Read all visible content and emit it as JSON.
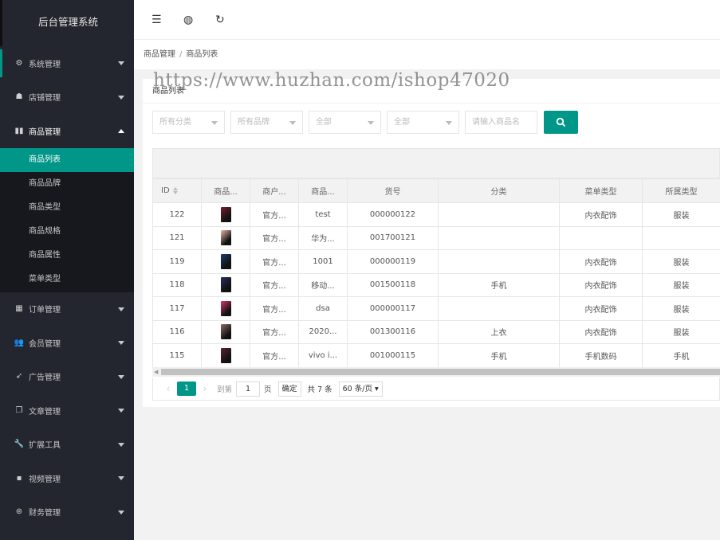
{
  "sidebar": {
    "brand": "后台管理系统",
    "items": [
      {
        "label": "系统管理",
        "icon": "gear-icon",
        "glyph": "⚙"
      },
      {
        "label": "店铺管理",
        "icon": "shop-icon",
        "glyph": "☗"
      },
      {
        "label": "商品管理",
        "icon": "chart-icon",
        "glyph": "▮▮"
      },
      {
        "label": "订单管理",
        "icon": "calendar-icon",
        "glyph": "▦"
      },
      {
        "label": "会员管理",
        "icon": "users-icon",
        "glyph": "👥"
      },
      {
        "label": "广告管理",
        "icon": "rocket-icon",
        "glyph": "➶"
      },
      {
        "label": "文章管理",
        "icon": "document-icon",
        "glyph": "❐"
      },
      {
        "label": "扩展工具",
        "icon": "wrench-icon",
        "glyph": "🔧"
      },
      {
        "label": "视频管理",
        "icon": "camera-icon",
        "glyph": "▪"
      },
      {
        "label": "财务管理",
        "icon": "finance-icon",
        "glyph": "⊛"
      }
    ],
    "submenu": [
      "商品列表",
      "商品品牌",
      "商品类型",
      "商品规格",
      "商品属性",
      "菜单类型"
    ]
  },
  "topbar": {
    "icons": [
      {
        "name": "menu-toggle-icon",
        "glyph": "☰"
      },
      {
        "name": "globe-icon",
        "glyph": "◍"
      },
      {
        "name": "refresh-icon",
        "glyph": "↻"
      }
    ]
  },
  "breadcrumb": {
    "parent": "商品管理",
    "separator": "/",
    "current": "商品列表"
  },
  "watermark": "https://www.huzhan.com/ishop47020",
  "card": {
    "title": "商品列表",
    "filters": {
      "category": "所有分类",
      "brand": "所有品牌",
      "all1": "全部",
      "all2": "全部",
      "search_placeholder": "请输入商品名"
    },
    "table": {
      "columns": [
        "ID",
        "商品...",
        "商户...",
        "商品...",
        "货号",
        "分类",
        "菜单类型",
        "所属类型"
      ],
      "rows": [
        {
          "id": "122",
          "img": "#7a1f2e",
          "merchant": "官方...",
          "name": "test",
          "sku": "000000122",
          "category": "",
          "menu_type": "内衣配饰",
          "type": "服装"
        },
        {
          "id": "121",
          "img": "#e9b9a8",
          "merchant": "官方...",
          "name": "华为...",
          "sku": "001700121",
          "category": "",
          "menu_type": "",
          "type": ""
        },
        {
          "id": "119",
          "img": "#1c3e6e",
          "merchant": "官方...",
          "name": "1001",
          "sku": "000000119",
          "category": "",
          "menu_type": "内衣配饰",
          "type": "服装"
        },
        {
          "id": "118",
          "img": "#2a2f5e",
          "merchant": "官方...",
          "name": "移动...",
          "sku": "001500118",
          "category": "手机",
          "menu_type": "内衣配饰",
          "type": "服装"
        },
        {
          "id": "117",
          "img": "#d8396b",
          "merchant": "官方...",
          "name": "dsa",
          "sku": "000000117",
          "category": "",
          "menu_type": "内衣配饰",
          "type": "服装"
        },
        {
          "id": "116",
          "img": "#8a6f66",
          "merchant": "官方...",
          "name": "2020...",
          "sku": "001300116",
          "category": "上衣",
          "menu_type": "内衣配饰",
          "type": "服装"
        },
        {
          "id": "115",
          "img": "#5a2431",
          "merchant": "官方...",
          "name": "vivo i...",
          "sku": "001000115",
          "category": "手机",
          "menu_type": "手机数码",
          "type": "手机"
        }
      ]
    },
    "pager": {
      "current": "1",
      "goto_label": "到第",
      "goto_value": "1",
      "page_unit": "页",
      "confirm": "确定",
      "total": "共 7 条",
      "limit": "60 条/页"
    }
  },
  "colors": {
    "accent": "#009688",
    "sidebar_bg": "#23262e",
    "submenu_bg": "#16181d"
  }
}
